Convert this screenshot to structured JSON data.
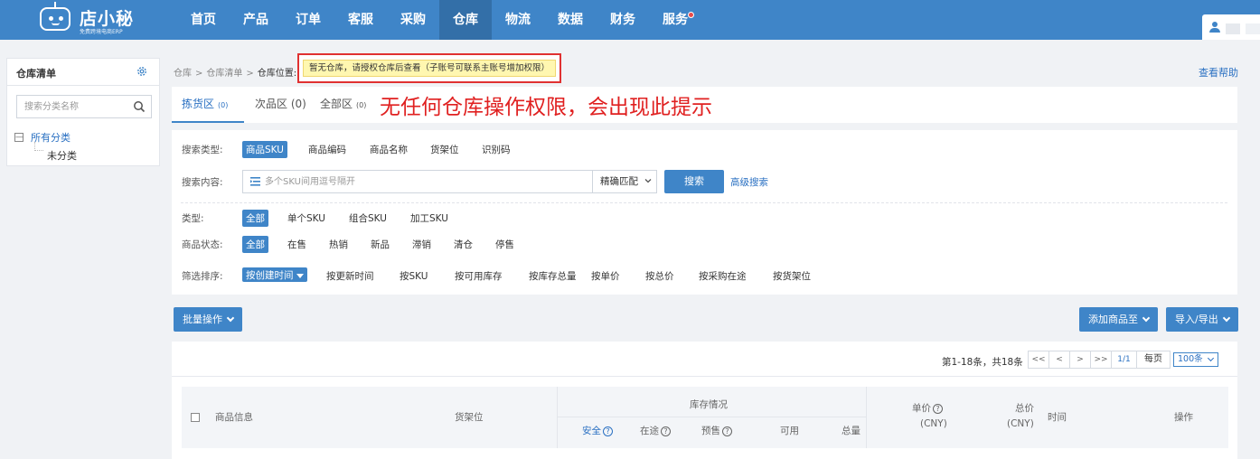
{
  "brand": {
    "name": "店小秘",
    "sub": "免费跨境电商ERP"
  },
  "nav": [
    {
      "label": "首页",
      "name": "nav-home"
    },
    {
      "label": "产品",
      "name": "nav-product"
    },
    {
      "label": "订单",
      "name": "nav-order"
    },
    {
      "label": "客服",
      "name": "nav-service"
    },
    {
      "label": "采购",
      "name": "nav-purchase"
    },
    {
      "label": "仓库",
      "name": "nav-warehouse",
      "active": true
    },
    {
      "label": "物流",
      "name": "nav-logistics"
    },
    {
      "label": "数据",
      "name": "nav-data"
    },
    {
      "label": "财务",
      "name": "nav-finance"
    },
    {
      "label": "服务",
      "name": "nav-services",
      "dot": true
    }
  ],
  "sidebar": {
    "title": "仓库清单",
    "search_placeholder": "搜索分类名称",
    "tree_toggle": "—",
    "root": "所有分类",
    "child": "未分类"
  },
  "breadcrumb": {
    "a": "仓库",
    "b": "仓库清单",
    "c": "仓库位置:"
  },
  "alert": "暂无仓库，请授权仓库后查看（子账号可联系主账号增加权限）",
  "help_link": "查看帮助",
  "tabs": {
    "pick": {
      "label": "拣货区",
      "count": "(0)"
    },
    "defect": {
      "label": "次品区 (0)"
    },
    "all": {
      "label": "全部区",
      "count": "(0)"
    }
  },
  "annotation": "无任何仓库操作权限，会出现此提示",
  "filters": {
    "search_type_label": "搜索类型:",
    "search_types": [
      "商品SKU",
      "商品编码",
      "商品名称",
      "货架位",
      "识别码"
    ],
    "content_label": "搜索内容:",
    "content_placeholder": "多个SKU间用逗号隔开",
    "match_mode": "精确匹配",
    "search_btn": "搜索",
    "advanced": "高级搜索",
    "type_label": "类型:",
    "types": [
      "全部",
      "单个SKU",
      "组合SKU",
      "加工SKU"
    ],
    "status_label": "商品状态:",
    "statuses": [
      "全部",
      "在售",
      "热销",
      "新品",
      "滞销",
      "清仓",
      "停售"
    ],
    "sort_label": "筛选排序:",
    "sort_selected": "按创建时间",
    "sorts": [
      "按更新时间",
      "按SKU",
      "按可用库存",
      "按库存总量",
      "按单价",
      "按总价",
      "按采购在途",
      "按货架位"
    ]
  },
  "actions": {
    "batch": "批量操作",
    "add_to": "添加商品至",
    "import_export": "导入/导出"
  },
  "pager": {
    "summary": "第1-18条，共18条",
    "buttons": [
      "<<",
      "<",
      ">",
      ">>"
    ],
    "current": "1/1",
    "per_page_label": "每页",
    "per_page": "100条"
  },
  "table": {
    "product": "商品信息",
    "shelf": "货架位",
    "stock": "库存情况",
    "safe": "安全",
    "transit": "在途",
    "presale": "预售",
    "available": "可用",
    "total": "总量",
    "unit_price": "单价",
    "cny": "(CNY)",
    "total_price": "总价",
    "time": "时间",
    "ops": "操作",
    "q": "?"
  }
}
